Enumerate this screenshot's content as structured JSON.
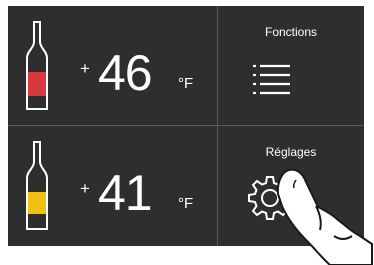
{
  "zones": [
    {
      "temperature": "46",
      "sign": "+",
      "unit": "°F",
      "indicator_color": "#d9383d"
    },
    {
      "temperature": "41",
      "sign": "+",
      "unit": "°F",
      "indicator_color": "#f2c10f"
    }
  ],
  "menu": {
    "functions_label": "Fonctions",
    "functions_icon": "list-menu-icon",
    "settings_label": "Réglages",
    "settings_icon": "gear-icon"
  },
  "colors": {
    "panel": "#2e2e2e",
    "divider": "#5a5a5a",
    "foreground": "#ffffff"
  }
}
